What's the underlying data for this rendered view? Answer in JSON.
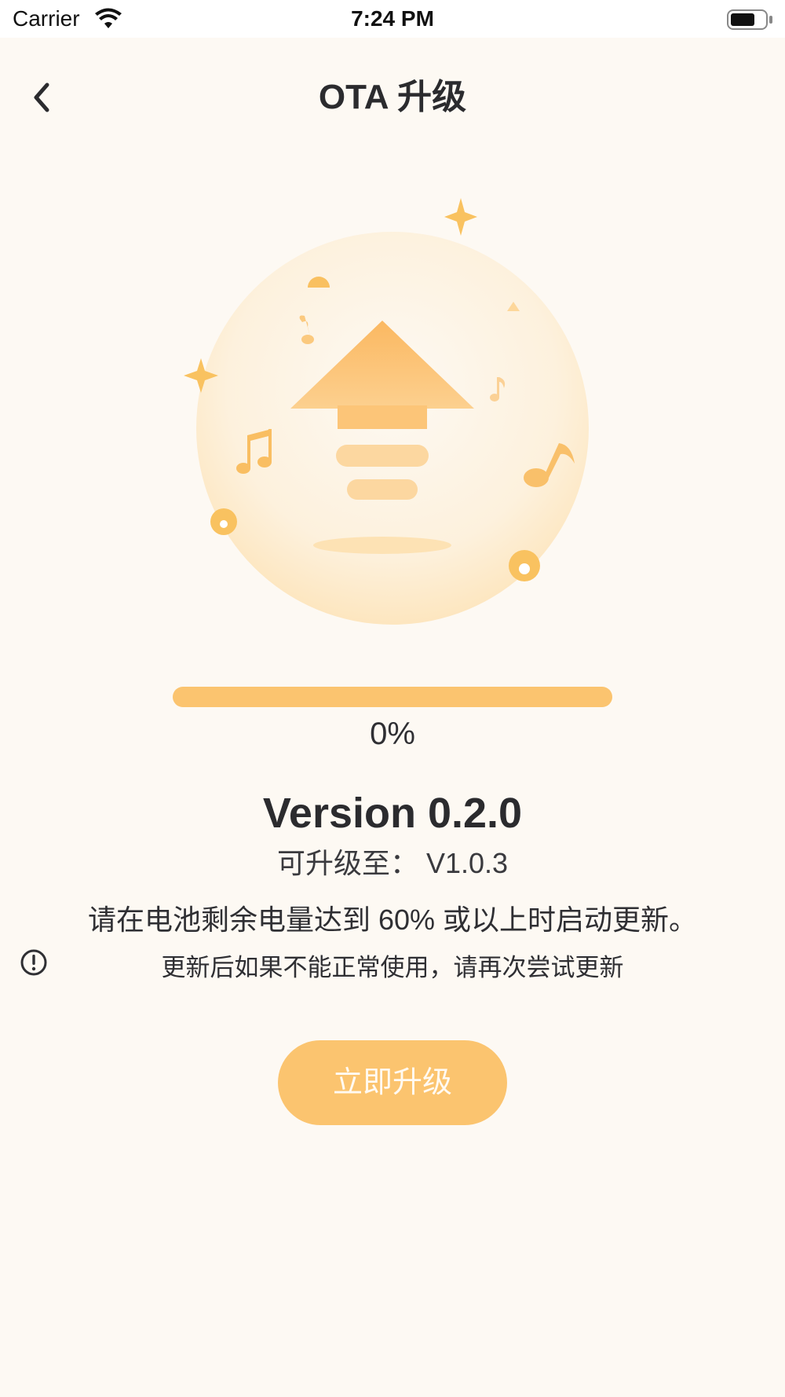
{
  "status_bar": {
    "carrier": "Carrier",
    "time": "7:24 PM",
    "wifi_icon": "wifi-icon",
    "battery_icon": "battery-icon"
  },
  "nav": {
    "back_icon": "chevron-left-icon",
    "title": "OTA 升级"
  },
  "illustration": {
    "icon": "upgrade-arrow-illustration"
  },
  "progress": {
    "value": 0,
    "label": "0%"
  },
  "version": {
    "current": "Version 0.2.0",
    "upgrade_to": "可升级至： V1.0.3"
  },
  "notes": {
    "battery": "请在电池剩余电量达到 60% 或以上时启动更新。",
    "retry": "更新后如果不能正常使用，请再次尝试更新",
    "info_icon": "exclamation-circle-icon"
  },
  "actions": {
    "upgrade_label": "立即升级"
  },
  "colors": {
    "background": "#fdf9f3",
    "accent": "#fbc46f",
    "text": "#2f2f33"
  }
}
